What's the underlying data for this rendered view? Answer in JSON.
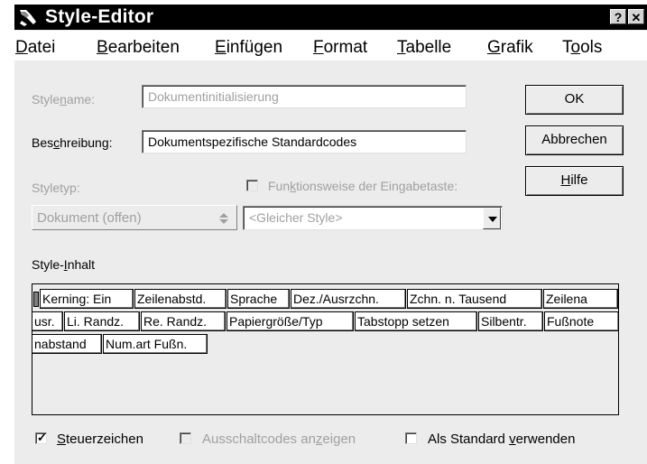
{
  "window": {
    "title": "Style-Editor",
    "help_button": "?",
    "close_button": "✕"
  },
  "menu": {
    "items": [
      {
        "accel": "D",
        "rest": "atei"
      },
      {
        "accel": "B",
        "rest": "earbeiten"
      },
      {
        "accel": "E",
        "rest": "infügen"
      },
      {
        "accel": "F",
        "rest": "ormat"
      },
      {
        "accel": "T",
        "rest": "abelle"
      },
      {
        "accel": "G",
        "rest": "rafik"
      },
      {
        "pre": "T",
        "accel": "o",
        "rest": "ols"
      }
    ]
  },
  "form": {
    "stylename_label": {
      "pre": "Style",
      "accel": "n",
      "rest": "ame:"
    },
    "stylename_value": "Dokumentinitialisierung",
    "beschreibung_label": {
      "pre": "Bes",
      "accel": "c",
      "rest": "hreibung:"
    },
    "beschreibung_value": "Dokumentspezifische Standardcodes",
    "styletyp_label": {
      "pre": "Styletyp",
      "accel": "",
      "rest": ":"
    },
    "styletyp_value": "Dokument (offen)",
    "enter_key_label": {
      "pre": "Fun",
      "accel": "k",
      "rest": "tionsweise der Eingabetaste:"
    },
    "enter_key_checked": false,
    "enter_key_select_value": "<Gleicher Style>",
    "style_inhalt_label": {
      "pre": "Style-",
      "accel": "I",
      "rest": "nhalt"
    }
  },
  "buttons": {
    "ok": "OK",
    "cancel": "Abbrechen",
    "help": {
      "accel": "H",
      "rest": "ilfe"
    }
  },
  "codes": {
    "row1": [
      "Kerning: Ein",
      "Zeilenabstd.",
      "Sprache",
      "Dez./Ausrzchn.",
      "Zchn. n. Tausend",
      "Zeilena"
    ],
    "row2": [
      "usr.",
      "Li. Randz.",
      "Re. Randz.",
      "Papiergröße/Typ",
      "Tabstopp setzen",
      "Silbentr.",
      "Fußnote"
    ],
    "row3": [
      "nabstand",
      "Num.art Fußn."
    ]
  },
  "options": {
    "steuerzeichen": {
      "accel": "S",
      "rest": "teuerzeichen",
      "checked": true
    },
    "ausschaltcodes": {
      "pre": "Ausschaltcodes an",
      "accel": "z",
      "rest": "eigen",
      "checked": false
    },
    "als_standard": {
      "pre": "Als Standard ",
      "accel": "v",
      "rest": "erwenden",
      "checked": false
    }
  }
}
